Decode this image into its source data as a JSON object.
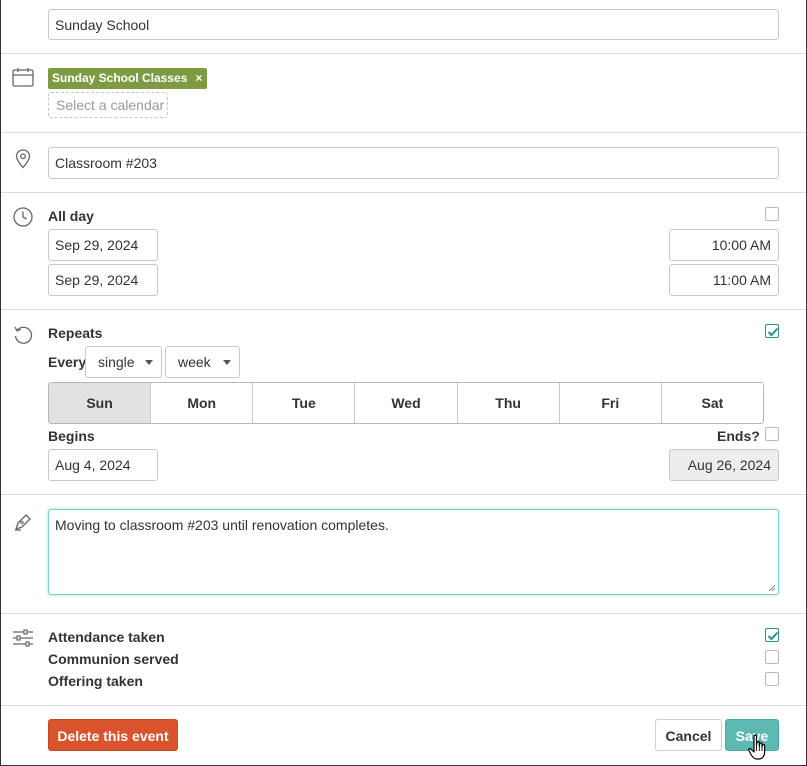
{
  "event": {
    "title_value": "Sunday School",
    "calendar_tag": "Sunday School Classes",
    "calendar_tag_remove": "×",
    "calendar_placeholder": "Select a calendar",
    "location_value": "Classroom #203"
  },
  "time": {
    "all_day_label": "All day",
    "all_day_checked": false,
    "start_date": "Sep 29, 2024",
    "end_date": "Sep 29, 2024",
    "start_time": "10:00 AM",
    "end_time": "11:00 AM"
  },
  "repeat": {
    "label": "Repeats",
    "checked": true,
    "every_label": "Every",
    "frequency_select": "single",
    "unit_select": "week",
    "days": [
      {
        "label": "Sun",
        "selected": true
      },
      {
        "label": "Mon",
        "selected": false
      },
      {
        "label": "Tue",
        "selected": false
      },
      {
        "label": "Wed",
        "selected": false
      },
      {
        "label": "Thu",
        "selected": false
      },
      {
        "label": "Fri",
        "selected": false
      },
      {
        "label": "Sat",
        "selected": false
      }
    ],
    "begins_label": "Begins",
    "begins_value": "Aug 4, 2024",
    "ends_label": "Ends?",
    "ends_checked": false,
    "ends_value": "Aug 26, 2024"
  },
  "notes": {
    "value": "Moving to classroom #203 until renovation completes."
  },
  "options": [
    {
      "label": "Attendance taken",
      "checked": true
    },
    {
      "label": "Communion served",
      "checked": false
    },
    {
      "label": "Offering taken",
      "checked": false
    }
  ],
  "buttons": {
    "delete_label": "Delete this event",
    "cancel_label": "Cancel",
    "save_label": "Save"
  },
  "colors": {
    "tag_green": "#7e9b44",
    "delete_red": "#d9532c",
    "save_teal": "#5fb9b3",
    "check_teal": "#2a8f8a"
  },
  "icons": [
    "calendar-icon",
    "location-pin-icon",
    "clock-icon",
    "repeat-icon",
    "pen-icon",
    "sliders-icon",
    "hand-cursor-icon",
    "resize-handle-icon"
  ]
}
